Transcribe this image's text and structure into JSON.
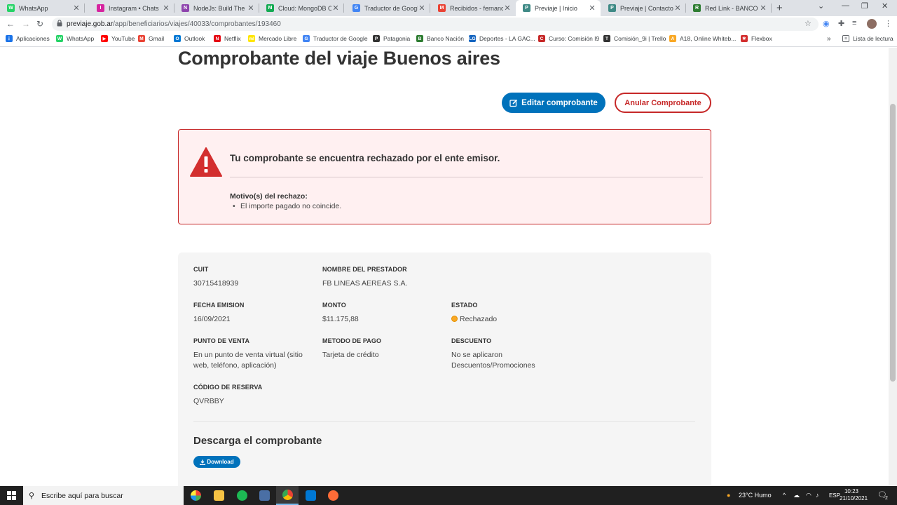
{
  "browser": {
    "tabs": [
      {
        "title": "WhatsApp",
        "color": "#25d366",
        "glyph": "W"
      },
      {
        "title": "Instagram • Chats",
        "color": "#d6249f",
        "glyph": "I"
      },
      {
        "title": "NodeJs: Build The Com",
        "color": "#8e44ad",
        "glyph": "N"
      },
      {
        "title": "Cloud: MongoDB Cloud",
        "color": "#13aa52",
        "glyph": "M"
      },
      {
        "title": "Traductor de Google",
        "color": "#4285f4",
        "glyph": "G"
      },
      {
        "title": "Recibidos - fernando",
        "color": "#ea4335",
        "glyph": "M"
      },
      {
        "title": "Previaje | Inicio",
        "color": "#3f8a86",
        "glyph": "P"
      },
      {
        "title": "Previaje | Contacto",
        "color": "#3f8a86",
        "glyph": "P"
      },
      {
        "title": "Red Link - BANCO DE",
        "color": "#2e7d32",
        "glyph": "R"
      }
    ],
    "url_host": "previaje.gob.ar",
    "url_path": "/app/beneficiarios/viajes/40033/comprobantes/193460",
    "bookmarks": [
      {
        "label": "Aplicaciones",
        "color": "#1a73e8",
        "glyph": "⋮"
      },
      {
        "label": "WhatsApp",
        "color": "#25d366",
        "glyph": "W"
      },
      {
        "label": "YouTube",
        "color": "#ff0000",
        "glyph": "▶"
      },
      {
        "label": "Gmail",
        "color": "#ea4335",
        "glyph": "M"
      },
      {
        "label": "Outlook",
        "color": "#0078d4",
        "glyph": "O"
      },
      {
        "label": "Netflix",
        "color": "#e50914",
        "glyph": "N"
      },
      {
        "label": "Mercado Libre",
        "color": "#ffe600",
        "glyph": "ml"
      },
      {
        "label": "Traductor de Google",
        "color": "#4285f4",
        "glyph": "G"
      },
      {
        "label": "Patagonia",
        "color": "#333333",
        "glyph": "P"
      },
      {
        "label": "Banco Nación",
        "color": "#2e7d32",
        "glyph": "B"
      },
      {
        "label": "Deportes - LA GAC...",
        "color": "#1565c0",
        "glyph": "LG"
      },
      {
        "label": "Curso: Comisión I9",
        "color": "#c62828",
        "glyph": "C"
      },
      {
        "label": "Comisión_9i | Trello",
        "color": "#333333",
        "glyph": "T"
      },
      {
        "label": "A18, Online Whiteb...",
        "color": "#f9a825",
        "glyph": "A"
      },
      {
        "label": "Flexbox",
        "color": "#d32f2f",
        "glyph": "✱"
      }
    ],
    "reading_list": "Lista de lectura"
  },
  "page": {
    "title": "Comprobante del viaje Buenos aires",
    "edit_button": "Editar comprobante",
    "cancel_button": "Anular Comprobante",
    "alert": {
      "message": "Tu comprobante se encuentra rechazado por el ente emisor.",
      "reasons_label": "Motivo(s) del rechazo:",
      "reason": "El importe pagado no coincide."
    },
    "details": {
      "cuit_label": "CUIT",
      "cuit": "30715418939",
      "prestador_label": "NOMBRE DEL PRESTADOR",
      "prestador": "FB LINEAS AEREAS S.A.",
      "fecha_label": "FECHA EMISION",
      "fecha": "16/09/2021",
      "monto_label": "MONTO",
      "monto": "$11.175,88",
      "estado_label": "ESTADO",
      "estado": "Rechazado",
      "punto_label": "PUNTO DE VENTA",
      "punto": "En un punto de venta virtual (sitio web, teléfono, aplicación)",
      "metodo_label": "METODO DE PAGO",
      "metodo": "Tarjeta de crédito",
      "descuento_label": "DESCUENTO",
      "descuento": "No se aplicaron Descuentos/Promociones",
      "reserva_label": "CÓDIGO DE RESERVA",
      "reserva": "QVRBBY"
    },
    "download_title": "Descarga el comprobante",
    "download_button": "Download"
  },
  "taskbar": {
    "search_placeholder": "Escribe aquí para buscar",
    "weather": "23°C  Humo",
    "lang": "ESP",
    "time": "10:23",
    "date": "21/10/2021",
    "notif_count": "2"
  }
}
